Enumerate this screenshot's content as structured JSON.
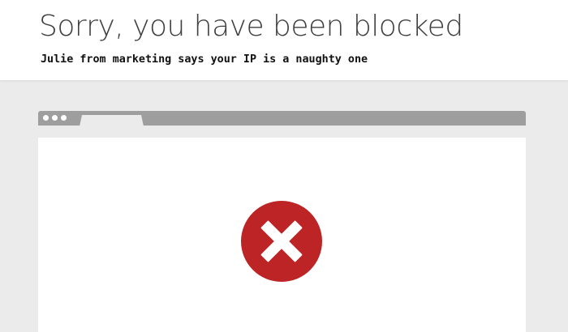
{
  "header": {
    "title": "Sorry, you have been blocked",
    "subtitle": "Julie from marketing says your IP is a naughty one"
  },
  "illustration": {
    "window_dots": [
      "dot",
      "dot",
      "dot"
    ],
    "icon": "error-x-icon",
    "icon_color": "#bd2426",
    "bar_color": "#9e9e9e",
    "background_color": "#ebebeb"
  }
}
